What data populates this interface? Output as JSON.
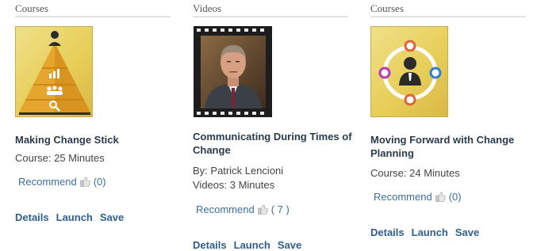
{
  "columns": [
    {
      "header": "Courses",
      "thumbnail_icon": "leadership-pyramid-icon",
      "title": "Making Change Stick",
      "meta_lines": [
        "Course: 25 Minutes"
      ],
      "recommend_label": "Recommend",
      "recommend_count": "(0)",
      "actions": {
        "details": "Details",
        "launch": "Launch",
        "save": "Save"
      }
    },
    {
      "header": "Videos",
      "thumbnail_icon": "video-presenter-thumbnail",
      "title": "Communicating During Times of Change",
      "meta_lines": [
        "By: Patrick Lencioni",
        "Videos: 3 Minutes"
      ],
      "recommend_label": "Recommend",
      "recommend_count": "( 7 )",
      "actions": {
        "details": "Details",
        "launch": "Launch",
        "save": "Save"
      }
    },
    {
      "header": "Courses",
      "thumbnail_icon": "change-planning-cycle-icon",
      "title": "Moving Forward with Change Planning",
      "meta_lines": [
        "Course: 24 Minutes"
      ],
      "recommend_label": "Recommend",
      "recommend_count": "(0)",
      "actions": {
        "details": "Details",
        "launch": "Launch",
        "save": "Save"
      }
    }
  ],
  "colors": {
    "title_text": "#2a3b4c",
    "link_text": "#2e5f8f",
    "recommend_text": "#3a6f9c",
    "course_thumb_gold": "#e8cf5a",
    "cycle_orange": "#e0643a",
    "cycle_purple": "#b43bb0",
    "cycle_blue": "#2e7fd0"
  }
}
